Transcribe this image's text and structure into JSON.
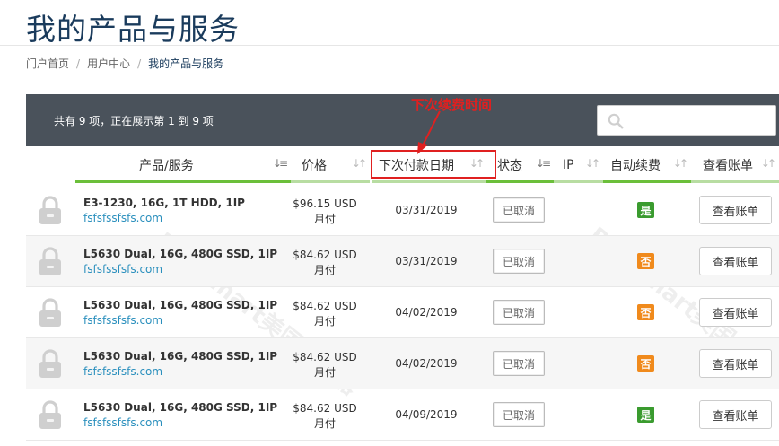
{
  "page": {
    "title": "我的产品与服务"
  },
  "breadcrumb": {
    "items": [
      "门户首页",
      "用户中心",
      "我的产品与服务"
    ]
  },
  "toolbar": {
    "info": "共有 9 项，正在展示第 1 到 9 项",
    "search_placeholder": ""
  },
  "annotation": {
    "label": "下次续费时间"
  },
  "table": {
    "columns": [
      "产品/服务",
      "价格",
      "下次付款日期",
      "状态",
      "IP",
      "自动续费",
      "查看账单"
    ],
    "rows": [
      {
        "product": "E3-1230, 16G, 1T HDD, 1IP",
        "domain": "fsfsfssfsfs.com",
        "price": "$96.15 USD",
        "cycle": "月付",
        "due": "03/31/2019",
        "status": "已取消",
        "auto": "是",
        "invoice": "查看账单"
      },
      {
        "product": "L5630 Dual, 16G, 480G SSD, 1IP",
        "domain": "fsfsfssfsfs.com",
        "price": "$84.62 USD",
        "cycle": "月付",
        "due": "03/31/2019",
        "status": "已取消",
        "auto": "否",
        "invoice": "查看账单"
      },
      {
        "product": "L5630 Dual, 16G, 480G SSD, 1IP",
        "domain": "fsfsfssfsfs.com",
        "price": "$84.62 USD",
        "cycle": "月付",
        "due": "04/02/2019",
        "status": "已取消",
        "auto": "否",
        "invoice": "查看账单"
      },
      {
        "product": "L5630 Dual, 16G, 480G SSD, 1IP",
        "domain": "fsfsfssfsfs.com",
        "price": "$84.62 USD",
        "cycle": "月付",
        "due": "04/02/2019",
        "status": "已取消",
        "auto": "否",
        "invoice": "查看账单"
      },
      {
        "product": "L5630 Dual, 16G, 480G SSD, 1IP",
        "domain": "fsfsfssfsfs.com",
        "price": "$84.62 USD",
        "cycle": "月付",
        "due": "04/09/2019",
        "status": "已取消",
        "auto": "是",
        "invoice": "查看账单"
      }
    ]
  },
  "colors": {
    "title": "#1a3b5c",
    "toolbar_bg": "#4a525b",
    "link": "#2a8fbd",
    "yes": "#3a9b2f",
    "no": "#f08a1c",
    "annotation": "#e02020"
  },
  "icons": {
    "search": "search-icon",
    "lock": "lock-icon",
    "sort": "sort-icon"
  }
}
